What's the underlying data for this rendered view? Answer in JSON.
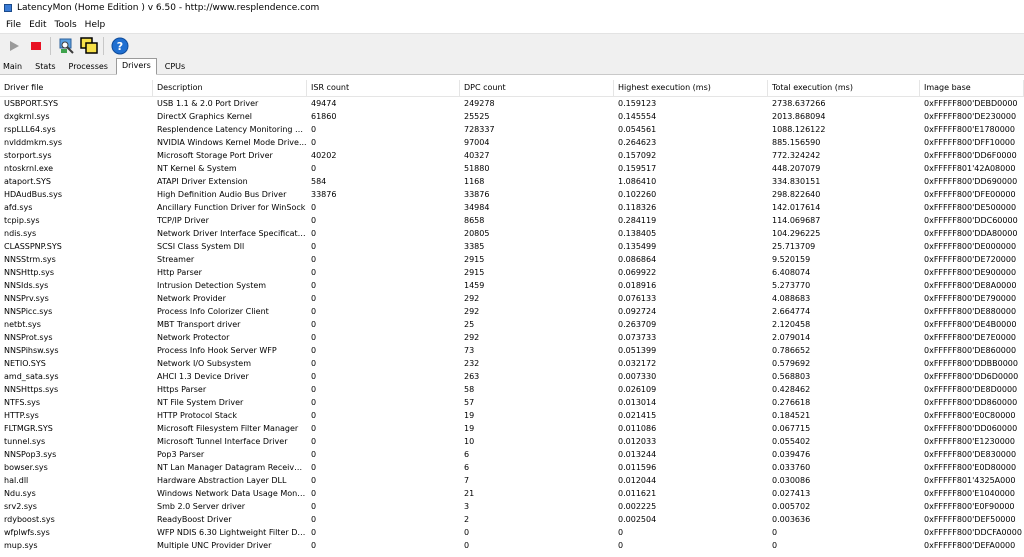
{
  "window": {
    "title": "LatencyMon  (Home Edition )  v 6.50 - http://www.resplendence.com"
  },
  "menu": [
    {
      "label": "File"
    },
    {
      "label": "Edit"
    },
    {
      "label": "Tools"
    },
    {
      "label": "Help"
    }
  ],
  "toolbar": {
    "buttons": [
      {
        "icon": "play-icon"
      },
      {
        "icon": "stop-icon"
      },
      {
        "icon": "analyze-icon"
      },
      {
        "icon": "windows-icon"
      },
      {
        "icon": "help-icon"
      }
    ],
    "colors": {
      "stop": "#e81123",
      "play": "#9a9a9a",
      "help": "#1f6fd1"
    }
  },
  "tabs": [
    {
      "label": "Main",
      "active": false
    },
    {
      "label": "Stats",
      "active": false
    },
    {
      "label": "Processes",
      "active": false
    },
    {
      "label": "Drivers",
      "active": true
    },
    {
      "label": "CPUs",
      "active": false
    }
  ],
  "table": {
    "columns": [
      "Driver file",
      "Description",
      "ISR count",
      "DPC count",
      "Highest execution (ms)",
      "Total execution (ms)",
      "Image base"
    ],
    "rows": [
      [
        "USBPORT.SYS",
        "USB 1.1 & 2.0 Port Driver",
        "49474",
        "249278",
        "0.159123",
        "2738.637266",
        "0xFFFFF800'DEBD0000"
      ],
      [
        "dxgkrnl.sys",
        "DirectX Graphics Kernel",
        "61860",
        "25525",
        "0.145554",
        "2013.868094",
        "0xFFFFF800'DE230000"
      ],
      [
        "rspLLL64.sys",
        "Resplendence Latency Monitoring a...",
        "0",
        "728337",
        "0.054561",
        "1088.126122",
        "0xFFFFF800'E1780000"
      ],
      [
        "nvlddmkm.sys",
        "NVIDIA Windows Kernel Mode Drive...",
        "0",
        "97004",
        "0.264623",
        "885.156590",
        "0xFFFFF800'DFF10000"
      ],
      [
        "storport.sys",
        "Microsoft Storage Port Driver",
        "40202",
        "40327",
        "0.157092",
        "772.324242",
        "0xFFFFF800'DD6F0000"
      ],
      [
        "ntoskrnl.exe",
        "NT Kernel & System",
        "0",
        "51880",
        "0.159517",
        "448.207079",
        "0xFFFFF801'42A08000"
      ],
      [
        "ataport.SYS",
        "ATAPI Driver Extension",
        "584",
        "1168",
        "1.086410",
        "334.830151",
        "0xFFFFF800'DD690000"
      ],
      [
        "HDAudBus.sys",
        "High Definition Audio Bus Driver",
        "33876",
        "33876",
        "0.102260",
        "298.822640",
        "0xFFFFF800'DFE00000"
      ],
      [
        "afd.sys",
        "Ancillary Function Driver for WinSock",
        "0",
        "34984",
        "0.118326",
        "142.017614",
        "0xFFFFF800'DE500000"
      ],
      [
        "tcpip.sys",
        "TCP/IP Driver",
        "0",
        "8658",
        "0.284119",
        "114.069687",
        "0xFFFFF800'DDC60000"
      ],
      [
        "ndis.sys",
        "Network Driver Interface Specificati...",
        "0",
        "20805",
        "0.138405",
        "104.296225",
        "0xFFFFF800'DDA80000"
      ],
      [
        "CLASSPNP.SYS",
        "SCSI Class System Dll",
        "0",
        "3385",
        "0.135499",
        "25.713709",
        "0xFFFFF800'DE000000"
      ],
      [
        "NNSStrm.sys",
        "Streamer",
        "0",
        "2915",
        "0.086864",
        "9.520159",
        "0xFFFFF800'DE720000"
      ],
      [
        "NNSHttp.sys",
        "Http Parser",
        "0",
        "2915",
        "0.069922",
        "6.408074",
        "0xFFFFF800'DE900000"
      ],
      [
        "NNSIds.sys",
        "Intrusion Detection System",
        "0",
        "1459",
        "0.018916",
        "5.273770",
        "0xFFFFF800'DE8A0000"
      ],
      [
        "NNSPrv.sys",
        "Network Provider",
        "0",
        "292",
        "0.076133",
        "4.088683",
        "0xFFFFF800'DE790000"
      ],
      [
        "NNSPicc.sys",
        "Process Info Colorizer Client",
        "0",
        "292",
        "0.092724",
        "2.664774",
        "0xFFFFF800'DE880000"
      ],
      [
        "netbt.sys",
        "MBT Transport driver",
        "0",
        "25",
        "0.263709",
        "2.120458",
        "0xFFFFF800'DE4B0000"
      ],
      [
        "NNSProt.sys",
        "Network Protector",
        "0",
        "292",
        "0.073733",
        "2.079014",
        "0xFFFFF800'DE7E0000"
      ],
      [
        "NNSPihsw.sys",
        "Process Info Hook Server WFP",
        "0",
        "73",
        "0.051399",
        "0.786652",
        "0xFFFFF800'DE860000"
      ],
      [
        "NETIO.SYS",
        "Network I/O Subsystem",
        "0",
        "232",
        "0.032172",
        "0.579692",
        "0xFFFFF800'DDBB0000"
      ],
      [
        "amd_sata.sys",
        "AHCI 1.3 Device Driver",
        "0",
        "263",
        "0.007330",
        "0.568803",
        "0xFFFFF800'DD6D0000"
      ],
      [
        "NNSHttps.sys",
        "Https Parser",
        "0",
        "58",
        "0.026109",
        "0.428462",
        "0xFFFFF800'DE8D0000"
      ],
      [
        "NTFS.sys",
        "NT File System Driver",
        "0",
        "57",
        "0.013014",
        "0.276618",
        "0xFFFFF800'DD860000"
      ],
      [
        "HTTP.sys",
        "HTTP Protocol Stack",
        "0",
        "19",
        "0.021415",
        "0.184521",
        "0xFFFFF800'E0C80000"
      ],
      [
        "FLTMGR.SYS",
        "Microsoft Filesystem Filter Manager",
        "0",
        "19",
        "0.011086",
        "0.067715",
        "0xFFFFF800'DD060000"
      ],
      [
        "tunnel.sys",
        "Microsoft Tunnel Interface Driver",
        "0",
        "10",
        "0.012033",
        "0.055402",
        "0xFFFFF800'E1230000"
      ],
      [
        "NNSPop3.sys",
        "Pop3 Parser",
        "0",
        "6",
        "0.013244",
        "0.039476",
        "0xFFFFF800'DE830000"
      ],
      [
        "bowser.sys",
        "NT Lan Manager Datagram Receiver...",
        "0",
        "6",
        "0.011596",
        "0.033760",
        "0xFFFFF800'E0D80000"
      ],
      [
        "hal.dll",
        "Hardware Abstraction Layer DLL",
        "0",
        "7",
        "0.012044",
        "0.030086",
        "0xFFFFF801'4325A000"
      ],
      [
        "Ndu.sys",
        "Windows Network Data Usage Monit...",
        "0",
        "21",
        "0.011621",
        "0.027413",
        "0xFFFFF800'E1040000"
      ],
      [
        "srv2.sys",
        "Smb 2.0 Server driver",
        "0",
        "3",
        "0.002225",
        "0.005702",
        "0xFFFFF800'E0F90000"
      ],
      [
        "rdyboost.sys",
        "ReadyBoost Driver",
        "0",
        "2",
        "0.002504",
        "0.003636",
        "0xFFFFF800'DEF50000"
      ],
      [
        "wfplwfs.sys",
        "WFP NDIS 6.30 Lightweight Filter Dr...",
        "0",
        "0",
        "0",
        "0",
        "0xFFFFF800'DDCFA0000"
      ],
      [
        "mup.sys",
        "Multiple UNC Provider Driver",
        "0",
        "0",
        "0",
        "0",
        "0xFFFFF800'DEFA0000"
      ]
    ]
  }
}
